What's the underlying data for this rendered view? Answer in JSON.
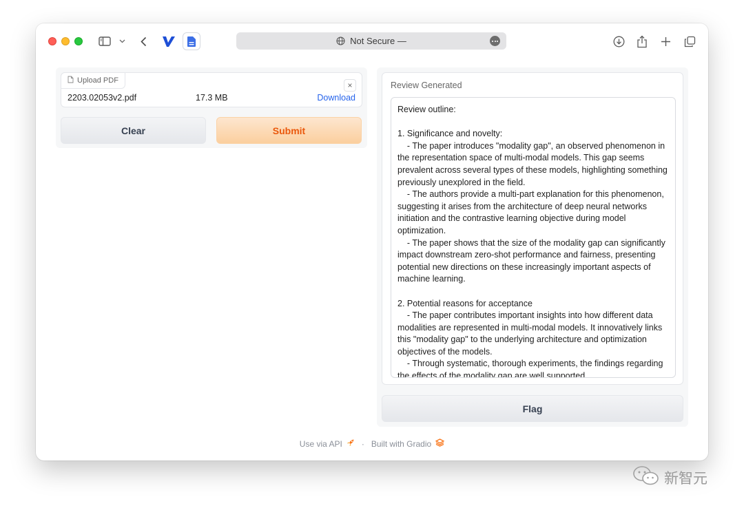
{
  "browser": {
    "address": "Not Secure —"
  },
  "upload": {
    "label": "Upload PDF",
    "close_symbol": "×",
    "file_name": "2203.02053v2.pdf",
    "file_size": "17.3 MB",
    "download_label": "Download"
  },
  "buttons": {
    "clear": "Clear",
    "submit": "Submit",
    "flag": "Flag"
  },
  "review": {
    "label": "Review Generated",
    "text": "Review outline:\n\n1. Significance and novelty:\n    - The paper introduces \"modality gap\", an observed phenomenon in the representation space of multi-modal models. This gap seems prevalent across several types of these models, highlighting something previously unexplored in the field.\n    - The authors provide a multi-part explanation for this phenomenon, suggesting it arises from the architecture of deep neural networks initiation and the contrastive learning objective during model optimization.\n    - The paper shows that the size of the modality gap can significantly impact downstream zero-shot performance and fairness, presenting potential new directions on these increasingly important aspects of machine learning.\n\n2. Potential reasons for acceptance\n    - The paper contributes important insights into how different data modalities are represented in multi-modal models. It innovatively links this \"modality gap\" to the underlying architecture and optimization objectives of the models.\n    - Through systematic, thorough experiments, the findings regarding the effects of the modality gap are well supported."
  },
  "footer": {
    "api": "Use via API",
    "separator": "·",
    "built": "Built with Gradio"
  },
  "watermark": "新智元",
  "colors": {
    "accent_orange": "#ea580c",
    "link_blue": "#2563eb"
  }
}
